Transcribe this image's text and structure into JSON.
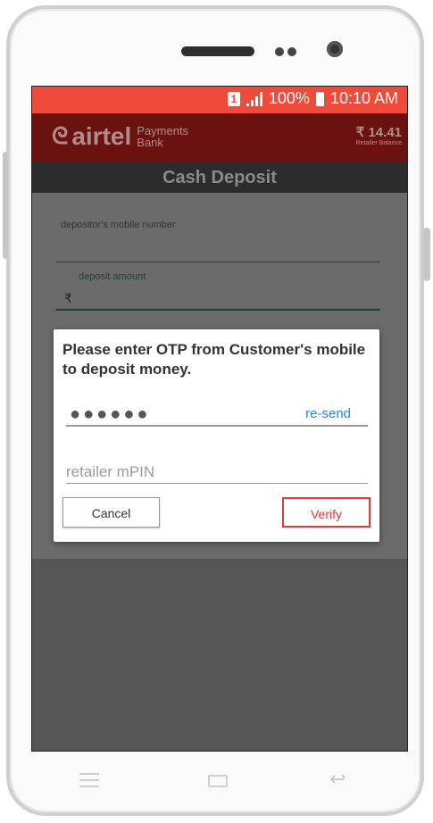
{
  "status_bar": {
    "sim": "1",
    "battery_percent": "100%",
    "time": "10:10 AM"
  },
  "app_bar": {
    "logo_word": "airtel",
    "logo_sub_line1": "Payments",
    "logo_sub_line2": "Bank",
    "balance_amount": "₹ 14.41",
    "balance_label": "Retailer Balance"
  },
  "page": {
    "title": "Cash Deposit"
  },
  "form": {
    "mobile_label": "depositor's mobile number",
    "amount_label": "deposit amount",
    "amount_prefix": "₹"
  },
  "otp_dialog": {
    "title": "Please enter OTP from Customer's mobile to deposit money.",
    "otp_masked": "●●●●●●",
    "resend_label": "re-send",
    "mpin_placeholder": "retailer mPIN",
    "cancel_label": "Cancel",
    "verify_label": "Verify"
  },
  "colors": {
    "status_bar": "#f04a3a",
    "app_bar": "#6b1210",
    "accent_link": "#1e88e5",
    "verify_border": "#e53935"
  }
}
